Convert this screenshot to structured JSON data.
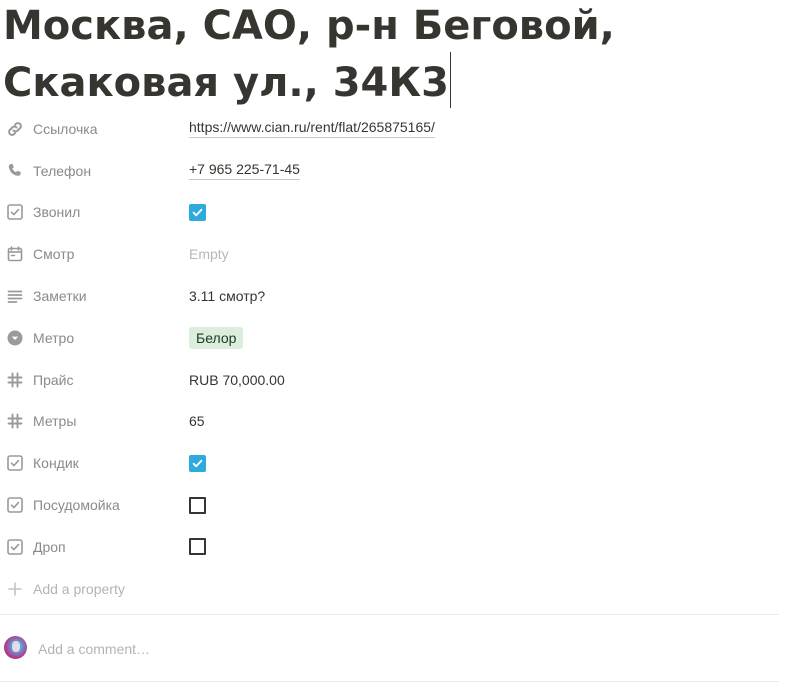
{
  "page": {
    "title_line1": "Москва, САО, р-н Беговой,",
    "title_line2": "Скаковая ул., 34К3"
  },
  "properties": [
    {
      "name": "Ссылочка",
      "icon": "link-icon",
      "type": "url",
      "value": "https://www.cian.ru/rent/flat/265875165/"
    },
    {
      "name": "Телефон",
      "icon": "phone-icon",
      "type": "phone",
      "value": "+7 965 225-71-45"
    },
    {
      "name": "Звонил",
      "icon": "checkbox-property-icon",
      "type": "checkbox",
      "checked": true
    },
    {
      "name": "Смотр",
      "icon": "calendar-icon",
      "type": "date",
      "value": "Empty"
    },
    {
      "name": "Заметки",
      "icon": "text-lines-icon",
      "type": "text",
      "value": "3.11 смотр?"
    },
    {
      "name": "Метро",
      "icon": "select-icon",
      "type": "select",
      "value": "Белор",
      "tag_color": "#dbeddb"
    },
    {
      "name": "Прайс",
      "icon": "hash-icon",
      "type": "number",
      "value": "RUB 70,000.00"
    },
    {
      "name": "Метры",
      "icon": "hash-icon",
      "type": "number",
      "value": "65"
    },
    {
      "name": "Кондик",
      "icon": "checkbox-property-icon",
      "type": "checkbox",
      "checked": true
    },
    {
      "name": "Посудомойка",
      "icon": "checkbox-property-icon",
      "type": "checkbox",
      "checked": false
    },
    {
      "name": "Дроп",
      "icon": "checkbox-property-icon",
      "type": "checkbox",
      "checked": false
    }
  ],
  "add_property": {
    "label": "Add a property",
    "icon": "plus-icon"
  },
  "comment": {
    "placeholder": "Add a comment…",
    "avatar_icon": "user-avatar"
  },
  "colors": {
    "checkbox_checked": "#2eaadc",
    "tag_background": "#dbeddb",
    "muted_text": "#8b8a87",
    "main_text": "#37352f"
  }
}
